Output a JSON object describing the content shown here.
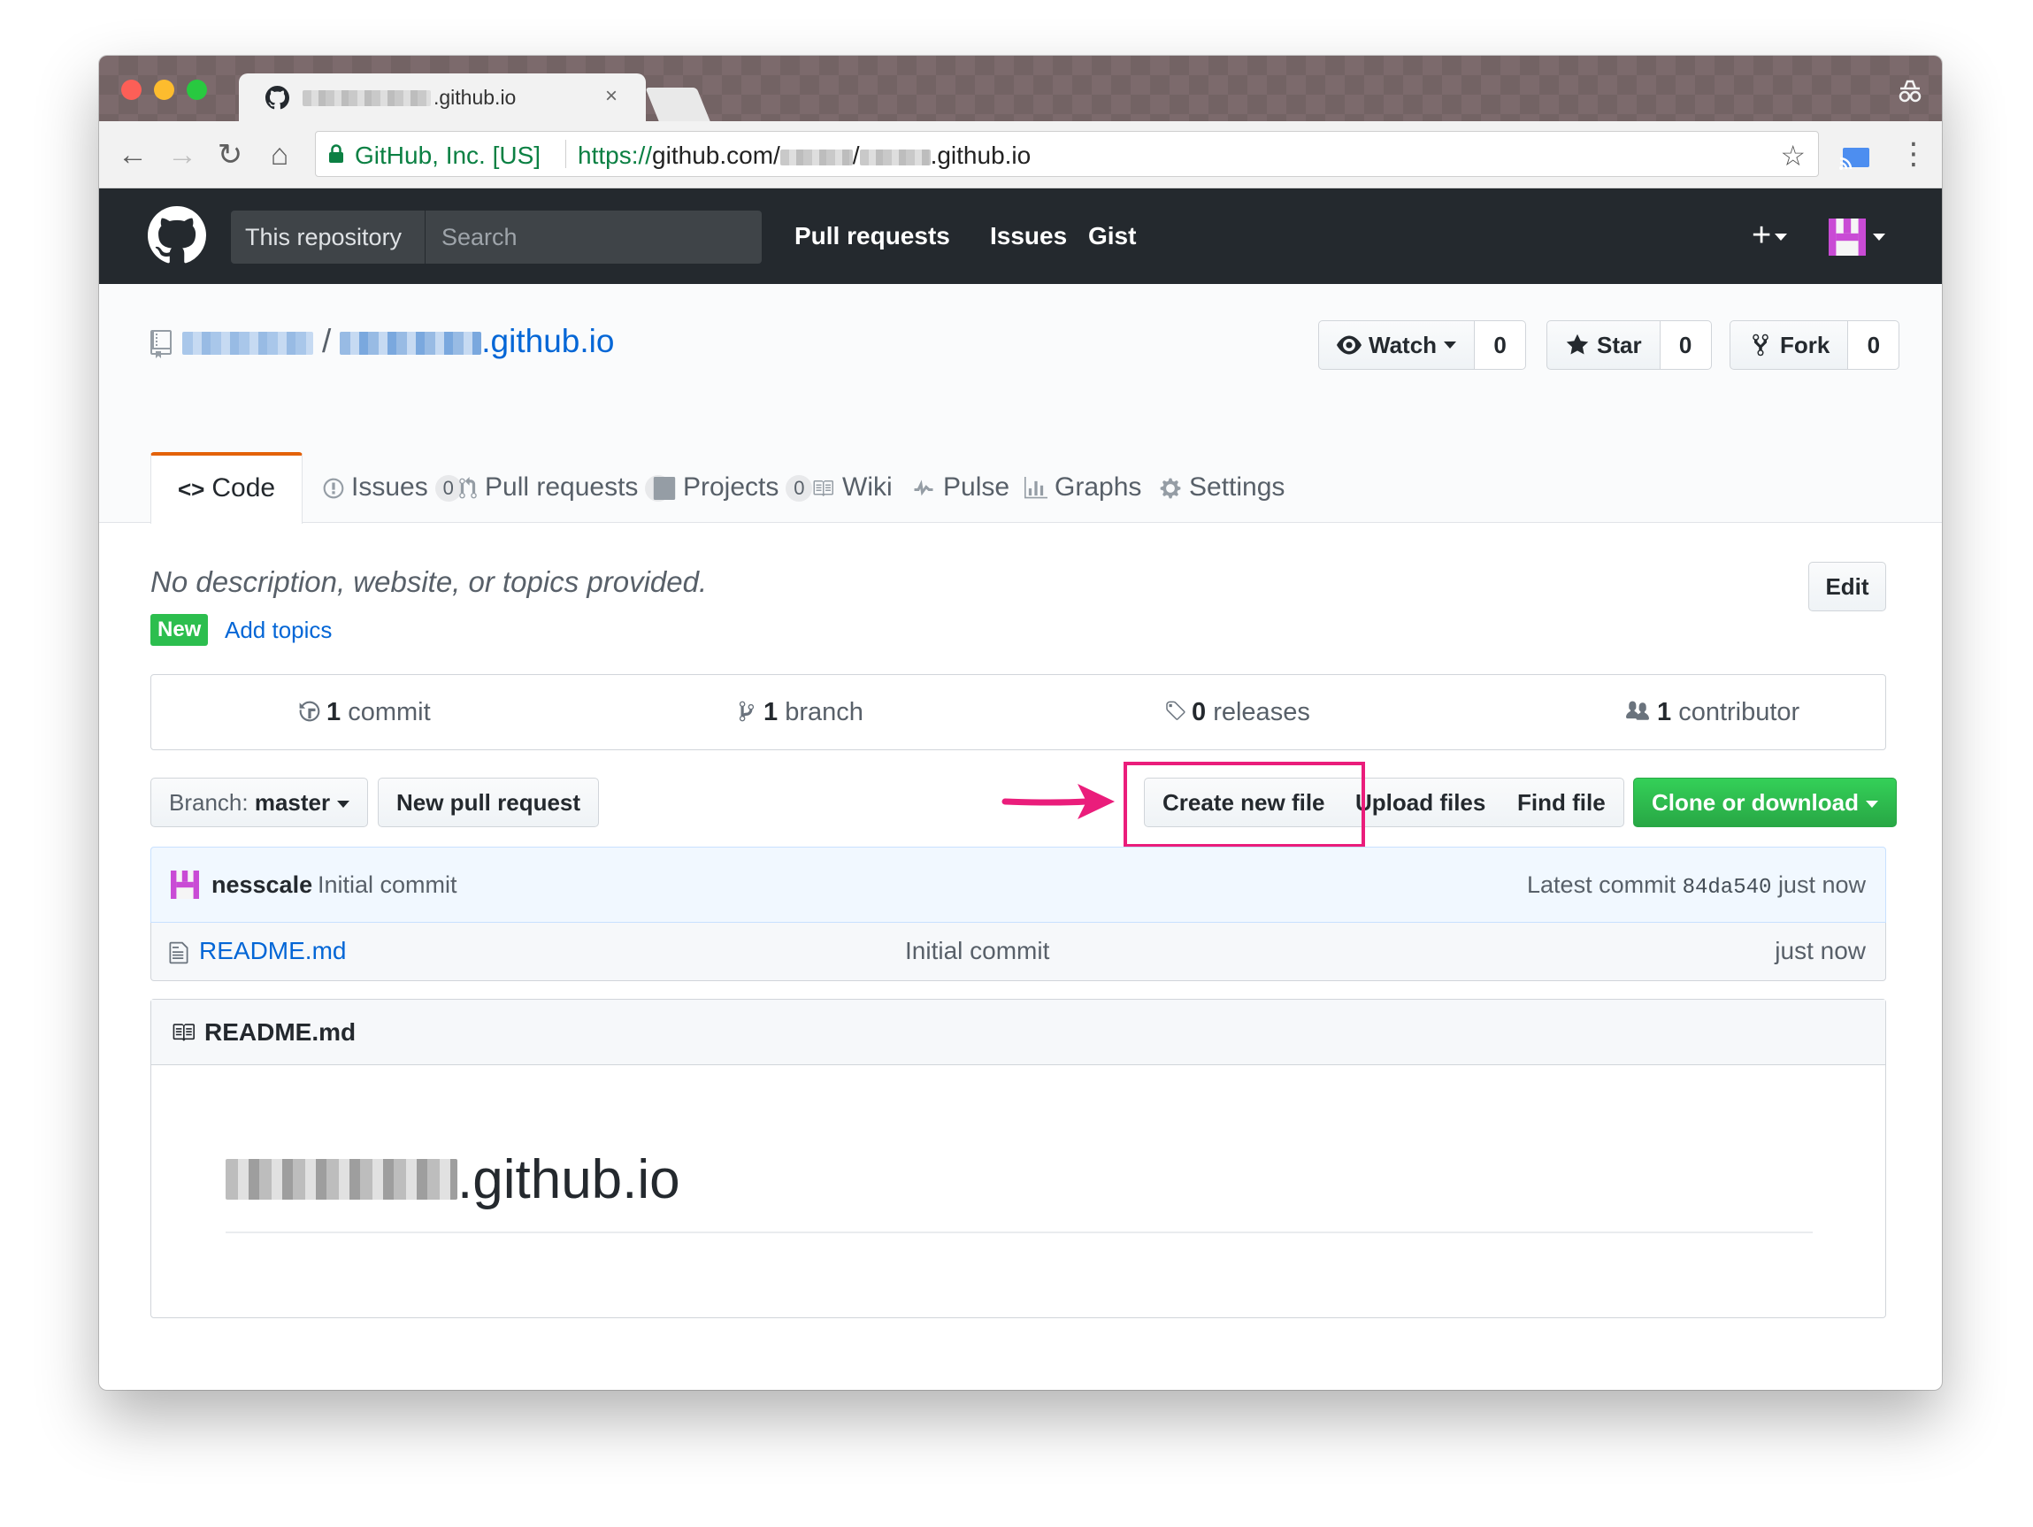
{
  "browser": {
    "tab_title": ".github.io",
    "tab_close": "×",
    "ev_label": "GitHub, Inc. [US]",
    "url_scheme": "https://",
    "url_host": "github.com/",
    "url_rest": "/",
    "url_suffix": ".github.io",
    "nav_back": "←",
    "nav_forward": "→",
    "nav_reload": "↻",
    "nav_home": "⌂",
    "star_glyph": "☆",
    "menu_glyph": "⋮"
  },
  "header": {
    "scope_label": "This repository",
    "search_placeholder": "Search",
    "nav": [
      "Pull requests",
      "Issues",
      "Gist"
    ],
    "plus_glyph": "+"
  },
  "repo": {
    "slash": "/",
    "name_suffix": ".github.io",
    "actions": {
      "watch_label": "Watch",
      "watch_count": "0",
      "star_label": "Star",
      "star_count": "0",
      "fork_label": "Fork",
      "fork_count": "0"
    },
    "tabs": [
      {
        "label": "Code",
        "icon": "<>"
      },
      {
        "label": "Issues",
        "count": "0",
        "icon": "issue-opened-icon"
      },
      {
        "label": "Pull requests",
        "count": "0",
        "icon": "git-pull-request-icon"
      },
      {
        "label": "Projects",
        "count": "0",
        "icon": "project-icon"
      },
      {
        "label": "Wiki",
        "icon": "book-icon"
      },
      {
        "label": "Pulse",
        "icon": "pulse-icon"
      },
      {
        "label": "Graphs",
        "icon": "graph-icon"
      },
      {
        "label": "Settings",
        "icon": "gear-icon"
      }
    ],
    "description": "No description, website, or topics provided.",
    "edit_label": "Edit",
    "new_badge": "New",
    "add_topics": "Add topics",
    "summary": {
      "commits_count": "1",
      "commits_label": "commit",
      "branch_count": "1",
      "branch_label": "branch",
      "releases_count": "0",
      "releases_label": "releases",
      "contrib_count": "1",
      "contrib_label": "contributor"
    },
    "file_nav": {
      "branch_prefix": "Branch:",
      "branch_name": "master",
      "new_pr": "New pull request",
      "create_file": "Create new file",
      "upload_files": "Upload files",
      "find_file": "Find file",
      "clone": "Clone or download"
    },
    "commit": {
      "author": "nesscale",
      "message": "Initial commit",
      "latest_prefix": "Latest commit",
      "sha": "84da540",
      "age": "just now"
    },
    "files": [
      {
        "name": "README.md",
        "message": "Initial commit",
        "age": "just now"
      }
    ],
    "readme": {
      "title": "README.md",
      "heading_suffix": ".github.io"
    }
  },
  "colors": {
    "header_bg": "#24292e",
    "link": "#0366d6",
    "selected_tab_border": "#e36209",
    "clone_green": "#28a745",
    "highlight": "#ea1d7b",
    "new_badge": "#2cbe4e"
  }
}
